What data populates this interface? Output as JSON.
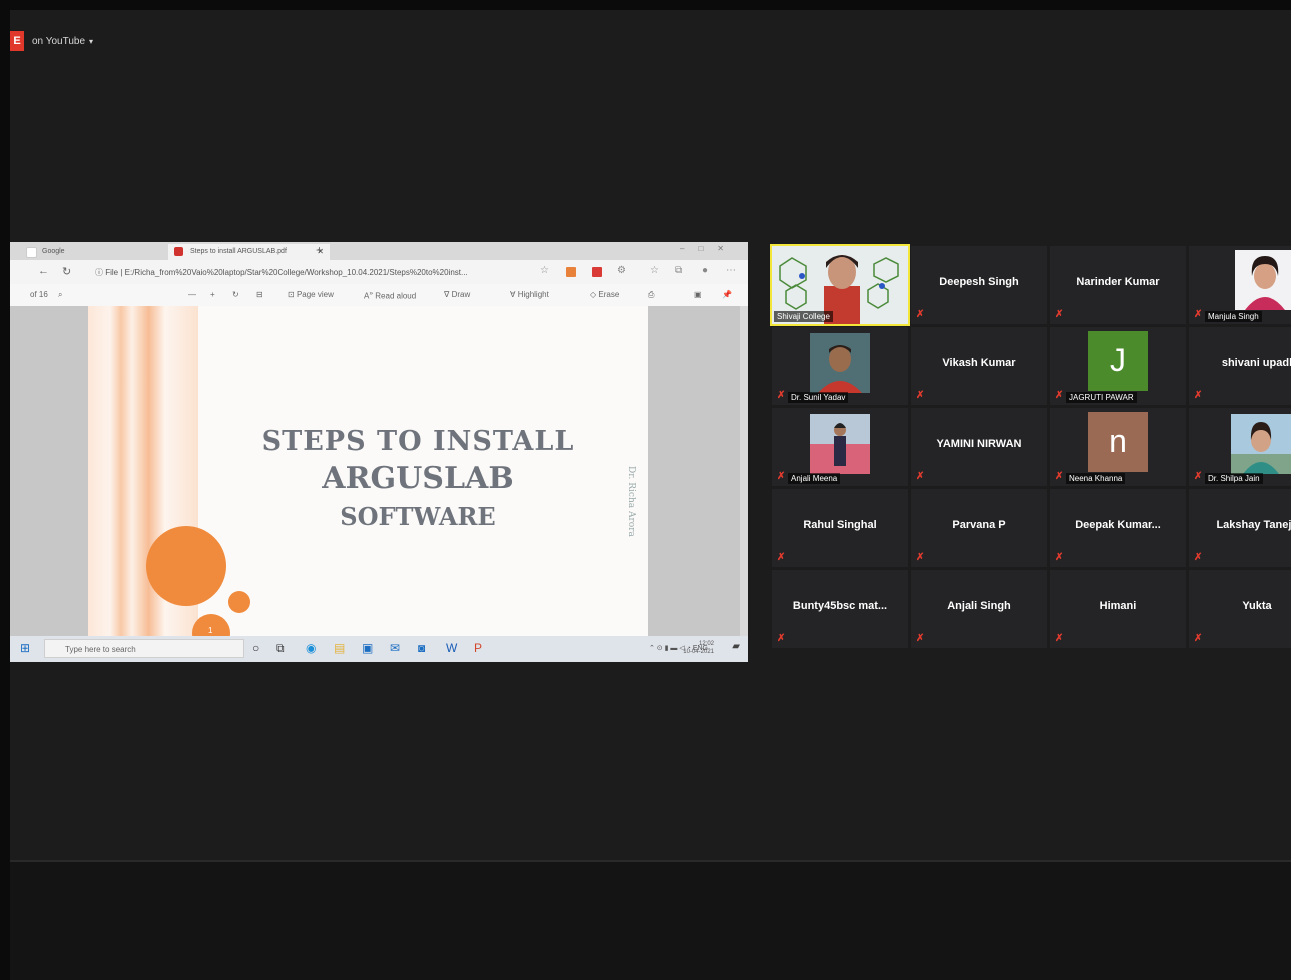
{
  "youtube_bar": {
    "badge": "E",
    "label": "on YouTube",
    "caret": "▾"
  },
  "browser": {
    "tabs": [
      {
        "label": "Google",
        "icon": "google-icon"
      },
      {
        "label": "Steps to install ARGUSLAB.pdf",
        "icon": "pdf-icon"
      }
    ],
    "new_tab": "+",
    "window_controls": "–□✕",
    "address": "ⓘ File  |  E:/Richa_from%20Vaio%20laptop/Star%20College/Workshop_10.04.2021/Steps%20to%20inst...",
    "pdf_toolbar": {
      "page": "of 16",
      "page_view": "Page view",
      "read_aloud": "Read aloud",
      "draw": "Draw",
      "highlight": "Highlight",
      "erase": "Erase"
    }
  },
  "slide": {
    "title_line1": "STEPS TO INSTALL",
    "title_line2": "ARGUSLAB",
    "title_line3": "SOFTWARE",
    "author": "Dr. Richa Arora",
    "slide_number": "1",
    "accent_color": "#f08a3c"
  },
  "taskbar": {
    "search_placeholder": "Type here to search",
    "lang": "ENG",
    "time": "12:02",
    "date": "10-04-2021"
  },
  "participants": [
    {
      "name": "Shivaji College",
      "type": "video",
      "muted": false,
      "active": true
    },
    {
      "name": "Deepesh Singh",
      "type": "text",
      "muted": true
    },
    {
      "name": "Narinder Kumar",
      "type": "text",
      "muted": true
    },
    {
      "name": "Manjula Singh",
      "type": "photo",
      "muted": true
    },
    {
      "name": "Dr. Sunil Yadav",
      "type": "photo",
      "muted": true
    },
    {
      "name": "Vikash Kumar",
      "type": "text",
      "muted": true
    },
    {
      "name": "JAGRUTI PAWAR",
      "type": "letter",
      "letter": "J",
      "color": "#4c8b2b",
      "muted": true
    },
    {
      "name": "shivani upadhyay",
      "type": "text",
      "muted": true
    },
    {
      "name": "Anjali Meena",
      "type": "photo",
      "muted": true
    },
    {
      "name": "YAMINI NIRWAN",
      "type": "text",
      "muted": true
    },
    {
      "name": "Neena Khanna",
      "type": "letter",
      "letter": "n",
      "color": "#9a6a55",
      "muted": true
    },
    {
      "name": "Dr. Shilpa Jain",
      "type": "photo",
      "muted": true
    },
    {
      "name": "Rahul Singhal",
      "type": "text",
      "muted": true
    },
    {
      "name": "Parvana P",
      "type": "text",
      "muted": true
    },
    {
      "name": "Deepak Kumar...",
      "type": "text",
      "muted": true
    },
    {
      "name": "Lakshay Taneja",
      "type": "text",
      "muted": true
    },
    {
      "name": "Bunty45bsc mat...",
      "type": "text",
      "muted": true
    },
    {
      "name": "Anjali Singh",
      "type": "text",
      "muted": true
    },
    {
      "name": "Himani",
      "type": "text",
      "muted": true
    },
    {
      "name": "Yukta",
      "type": "text",
      "muted": true
    }
  ]
}
